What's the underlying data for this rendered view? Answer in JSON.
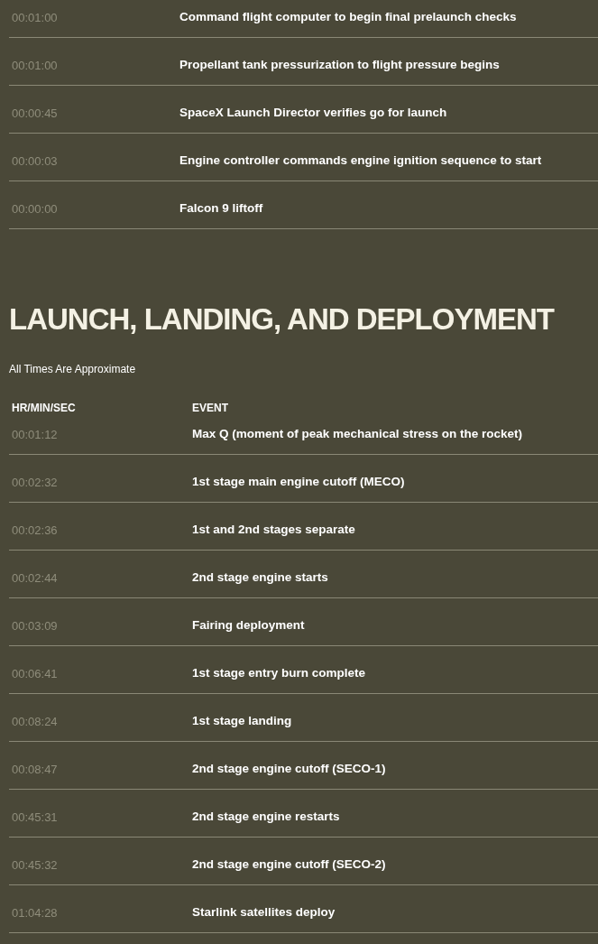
{
  "countdown_table": {
    "rows": [
      {
        "time": "00:01:00",
        "event": "Command flight computer to begin final prelaunch checks"
      },
      {
        "time": "00:01:00",
        "event": "Propellant tank pressurization to flight pressure begins"
      },
      {
        "time": "00:00:45",
        "event": "SpaceX Launch Director verifies go for launch"
      },
      {
        "time": "00:00:03",
        "event": "Engine controller commands engine ignition sequence to start"
      },
      {
        "time": "00:00:00",
        "event": "Falcon 9 liftoff"
      }
    ]
  },
  "section": {
    "title": "LAUNCH, LANDING, AND DEPLOYMENT",
    "note": "All Times Are Approximate"
  },
  "launch_table": {
    "columns": [
      "HR/MIN/SEC",
      "EVENT"
    ],
    "rows": [
      {
        "time": "00:01:12",
        "event": "Max Q (moment of peak mechanical stress on the rocket)"
      },
      {
        "time": "00:02:32",
        "event": "1st stage main engine cutoff (MECO)"
      },
      {
        "time": "00:02:36",
        "event": "1st and 2nd stages separate"
      },
      {
        "time": "00:02:44",
        "event": "2nd stage engine starts"
      },
      {
        "time": "00:03:09",
        "event": "Fairing deployment"
      },
      {
        "time": "00:06:41",
        "event": "1st stage entry burn complete"
      },
      {
        "time": "00:08:24",
        "event": "1st stage landing"
      },
      {
        "time": "00:08:47",
        "event": "2nd stage engine cutoff (SECO-1)"
      },
      {
        "time": "00:45:31",
        "event": "2nd stage engine restarts"
      },
      {
        "time": "00:45:32",
        "event": "2nd stage engine cutoff (SECO-2)"
      },
      {
        "time": "01:04:28",
        "event": "Starlink satellites deploy"
      }
    ]
  }
}
